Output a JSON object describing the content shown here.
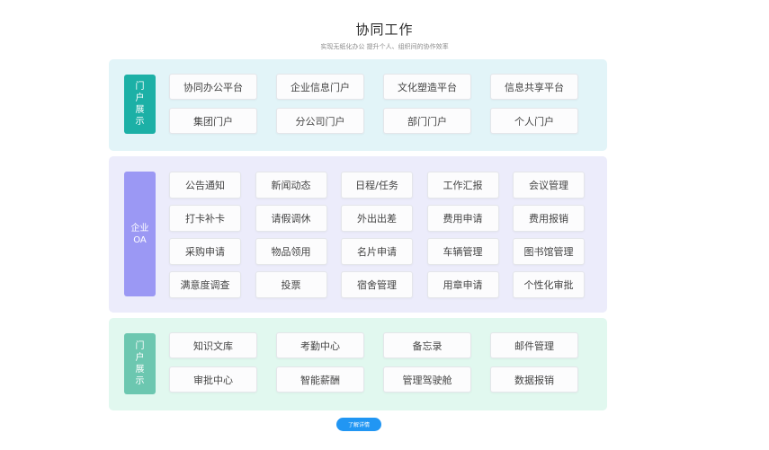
{
  "header": {
    "title": "协同工作",
    "subtitle": "实现无纸化办公 提升个人、组织间的协作效率"
  },
  "portal": {
    "label": "门户展示",
    "items": [
      "协同办公平台",
      "企业信息门户",
      "文化塑造平台",
      "信息共享平台",
      "集团门户",
      "分公司门户",
      "部门门户",
      "个人门户"
    ]
  },
  "oa": {
    "label_line1": "企业",
    "label_line2": "OA",
    "items": [
      "公告通知",
      "新闻动态",
      "日程/任务",
      "工作汇报",
      "会议管理",
      "打卡补卡",
      "请假调休",
      "外出出差",
      "费用申请",
      "费用报销",
      "采购申请",
      "物品领用",
      "名片申请",
      "车辆管理",
      "图书馆管理",
      "满意度调查",
      "投票",
      "宿舍管理",
      "用章申请",
      "个性化审批"
    ]
  },
  "tools": {
    "label": "门户展示",
    "items": [
      "知识文库",
      "考勤中心",
      "备忘录",
      "邮件管理",
      "审批中心",
      "智能薪酬",
      "管理驾驶舱",
      "数据报销"
    ]
  },
  "footer": {
    "more_label": "了解详情"
  },
  "colors": {
    "portal_bg": "#e2f4f8",
    "portal_label": "#1cb0a6",
    "oa_bg": "#ececfb",
    "oa_label": "#9b98f4",
    "tools_bg": "#e1f8ef",
    "tools_label": "#6cc7b0",
    "more_button": "#2196f3"
  }
}
